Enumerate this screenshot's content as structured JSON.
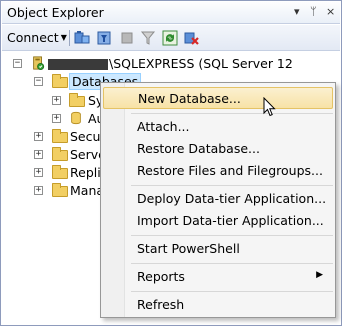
{
  "panel": {
    "title": "Object Explorer",
    "controls": [
      "▾",
      "ᛘ",
      "×"
    ]
  },
  "toolbar": {
    "connect_label": "Connect",
    "icons": [
      "connect-db-icon",
      "filter-icon",
      "stop-icon",
      "filter-settings-icon",
      "refresh-icon",
      "disconnect-icon"
    ]
  },
  "tree": {
    "server": {
      "label": "\\SQLEXPRESS (SQL Server 12",
      "expander": "−"
    },
    "databases": {
      "label": "Databases",
      "expander": "−"
    },
    "children_db": [
      {
        "label": "Sy",
        "expander": "+"
      },
      {
        "label": "Au",
        "expander": "+"
      }
    ],
    "folders": [
      {
        "label": "Securi",
        "expander": "+"
      },
      {
        "label": "Server",
        "expander": "+"
      },
      {
        "label": "Replic",
        "expander": "+"
      },
      {
        "label": "Mana",
        "expander": "+"
      }
    ]
  },
  "context_menu": {
    "items": [
      {
        "label": "New Database..."
      },
      {
        "label": "Attach..."
      },
      {
        "label": "Restore Database..."
      },
      {
        "label": "Restore Files and Filegroups..."
      },
      {
        "label": "Deploy Data-tier Application..."
      },
      {
        "label": "Import Data-tier Application..."
      },
      {
        "label": "Start PowerShell"
      },
      {
        "label": "Reports",
        "submenu_arrow": "▶"
      },
      {
        "label": "Refresh"
      }
    ]
  },
  "colors": {
    "selection": "#cce8ff",
    "menu_highlight": "#f7e2a6",
    "folder": "#f2cf63"
  }
}
